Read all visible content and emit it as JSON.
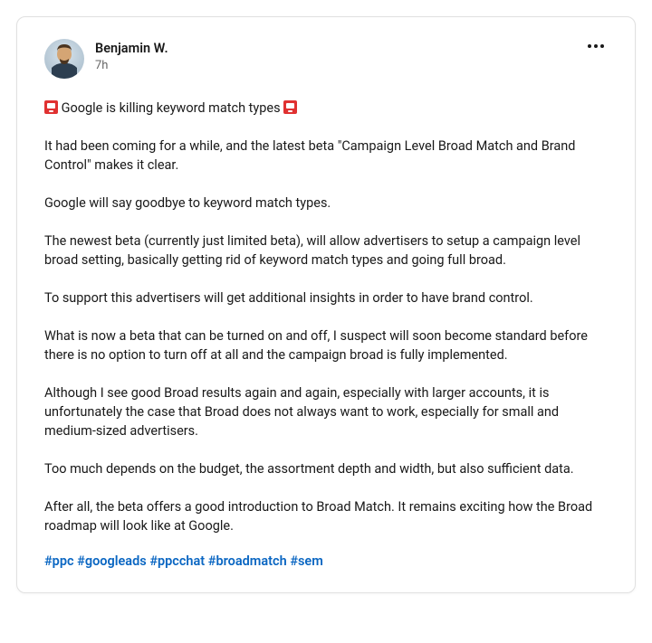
{
  "post": {
    "author": {
      "name": "Benjamin W.",
      "timestamp": "7h"
    },
    "body": {
      "line1_prefix_emoji": "alarm",
      "line1_text": " Google is killing keyword match types ",
      "line1_suffix_emoji": "alarm",
      "paragraphs": [
        "It had been coming for a while, and the latest beta \"Campaign Level Broad Match and Brand Control\" makes it clear.",
        "Google will say goodbye to keyword match types.",
        "The newest beta (currently just limited beta), will allow advertisers to setup a campaign level broad setting, basically getting rid of keyword match types and going full broad.",
        "To support this advertisers will get additional insights in order to have brand control.",
        "What is now a beta that can be turned on and off, I suspect will soon become standard before there is no option to turn off at all and the campaign broad is fully implemented.",
        "Although I see good Broad results again and again, especially with larger accounts, it is unfortunately the case that Broad does not always want to work, especially for small and medium-sized advertisers.",
        "Too much depends on the budget, the assortment depth and width, but also sufficient data.",
        "After all, the beta offers a good introduction to Broad Match. It remains exciting how the Broad roadmap will look like at Google."
      ]
    },
    "hashtags": [
      "#ppc",
      "#googleads",
      "#ppcchat",
      "#broadmatch",
      "#sem"
    ]
  }
}
